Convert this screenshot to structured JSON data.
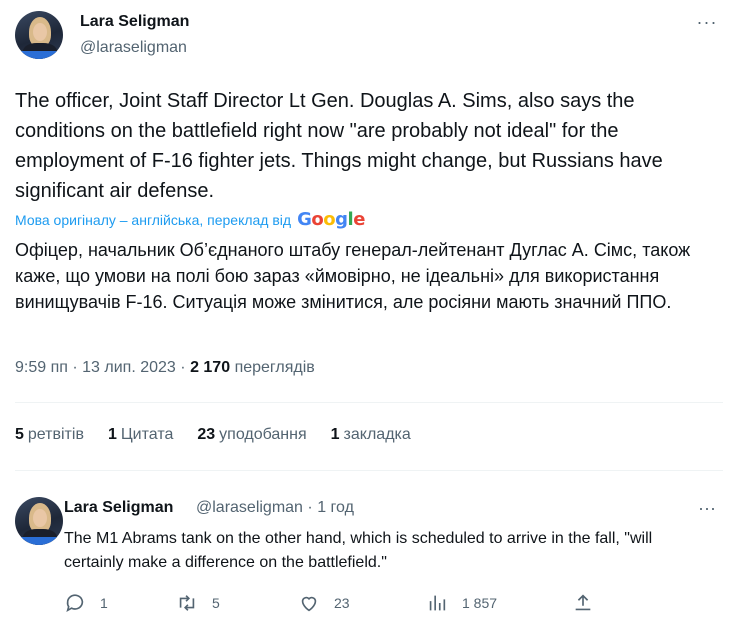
{
  "tweet": {
    "author_name": "Lara Seligman",
    "author_handle": "@laraseligman",
    "text": "The officer, Joint Staff Director Lt Gen. Douglas A. Sims, also says the conditions on the battlefield right now \"are probably not ideal\" for the employment of F-16 fighter jets. Things might change, but Russians have significant air defense.",
    "translation_note": "Мова оригіналу – англійська, переклад від",
    "translation_provider": "Google",
    "translated_text": "Офіцер, начальник Об’єднаного штабу генерал-лейтенант Дуглас А. Сімс, також каже, що умови на полі бою зараз «ймовірно, не ідеальні» для використання винищувачів F-16. Ситуація може змінитися, але росіяни мають значний ППО.",
    "time": "9:59 пп",
    "separator": "·",
    "date": "13 лип. 2023",
    "views_count": "2 170",
    "views_label": "переглядів",
    "more_icon": "more-horizontal-icon"
  },
  "stats": {
    "retweets_count": "5",
    "retweets_label": "ретвітів",
    "quotes_count": "1",
    "quotes_label": "Цитата",
    "likes_count": "23",
    "likes_label": "уподобання",
    "bookmarks_count": "1",
    "bookmarks_label": "закладка"
  },
  "reply": {
    "author_name": "Lara Seligman",
    "author_handle": "@laraseligman",
    "separator": "·",
    "age": "1 год",
    "text": "The M1 Abrams tank on the other hand, which is scheduled to arrive in the fall, \"will certainly make a difference on the battlefield.\"",
    "actions": {
      "reply_count": "1",
      "retweet_count": "5",
      "like_count": "23",
      "views_count": "1 857"
    }
  },
  "colors": {
    "link_blue": "#1d9bf0",
    "muted_text": "#536471",
    "divider": "#eff3f4"
  }
}
